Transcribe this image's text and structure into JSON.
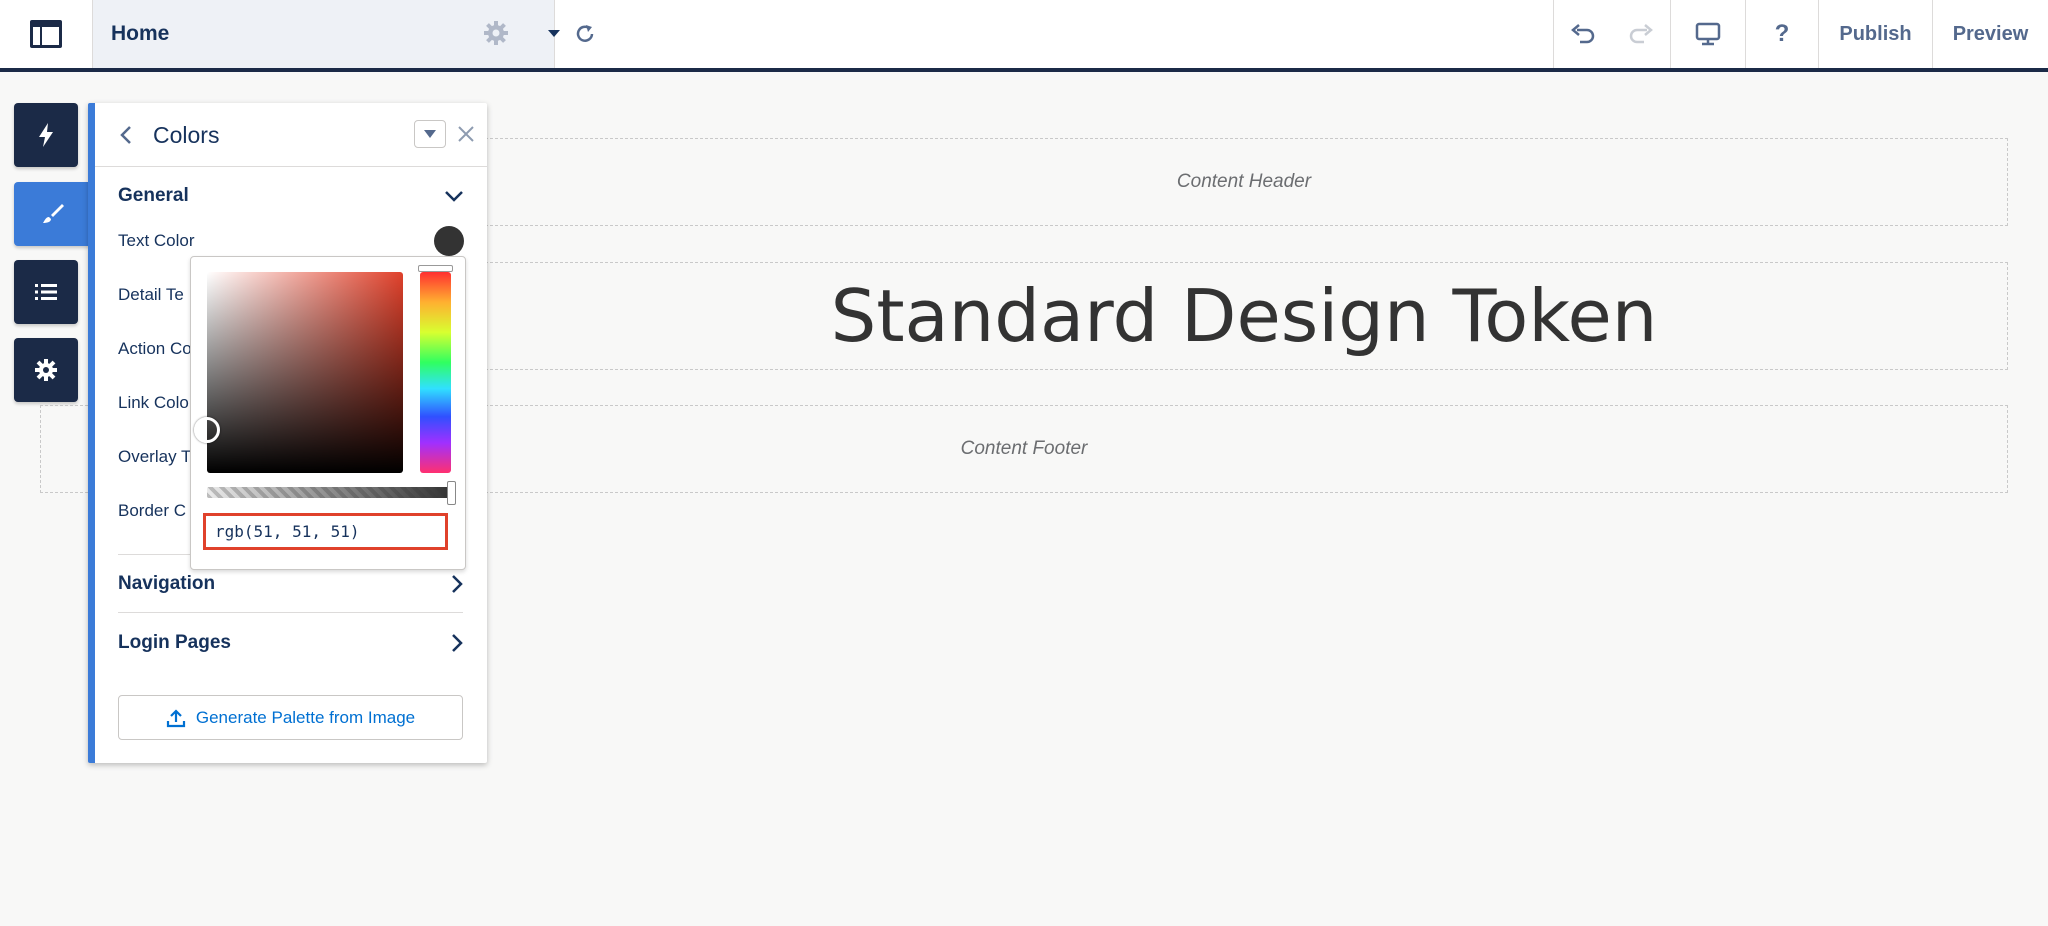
{
  "topbar": {
    "page_name": "Home",
    "publish_label": "Publish",
    "preview_label": "Preview",
    "help_label": "?"
  },
  "canvas": {
    "header_label": "Content Header",
    "hero_text": "Standard Design Token",
    "footer_label": "Content Footer"
  },
  "panel": {
    "title": "Colors",
    "general_label": "General",
    "properties": [
      "Text Color",
      "Detail Te",
      "Action Co",
      "Link Colo",
      "Overlay T",
      "Border C"
    ],
    "navigation_label": "Navigation",
    "login_label": "Login Pages",
    "generate_button_label": "Generate Palette from Image"
  },
  "picker": {
    "value": "rgb(51, 51, 51)"
  },
  "colors": {
    "accent": "#3b7bd8",
    "dark_navy": "#1b2a47",
    "error_border": "#e0412b",
    "swatch": "#333333"
  }
}
